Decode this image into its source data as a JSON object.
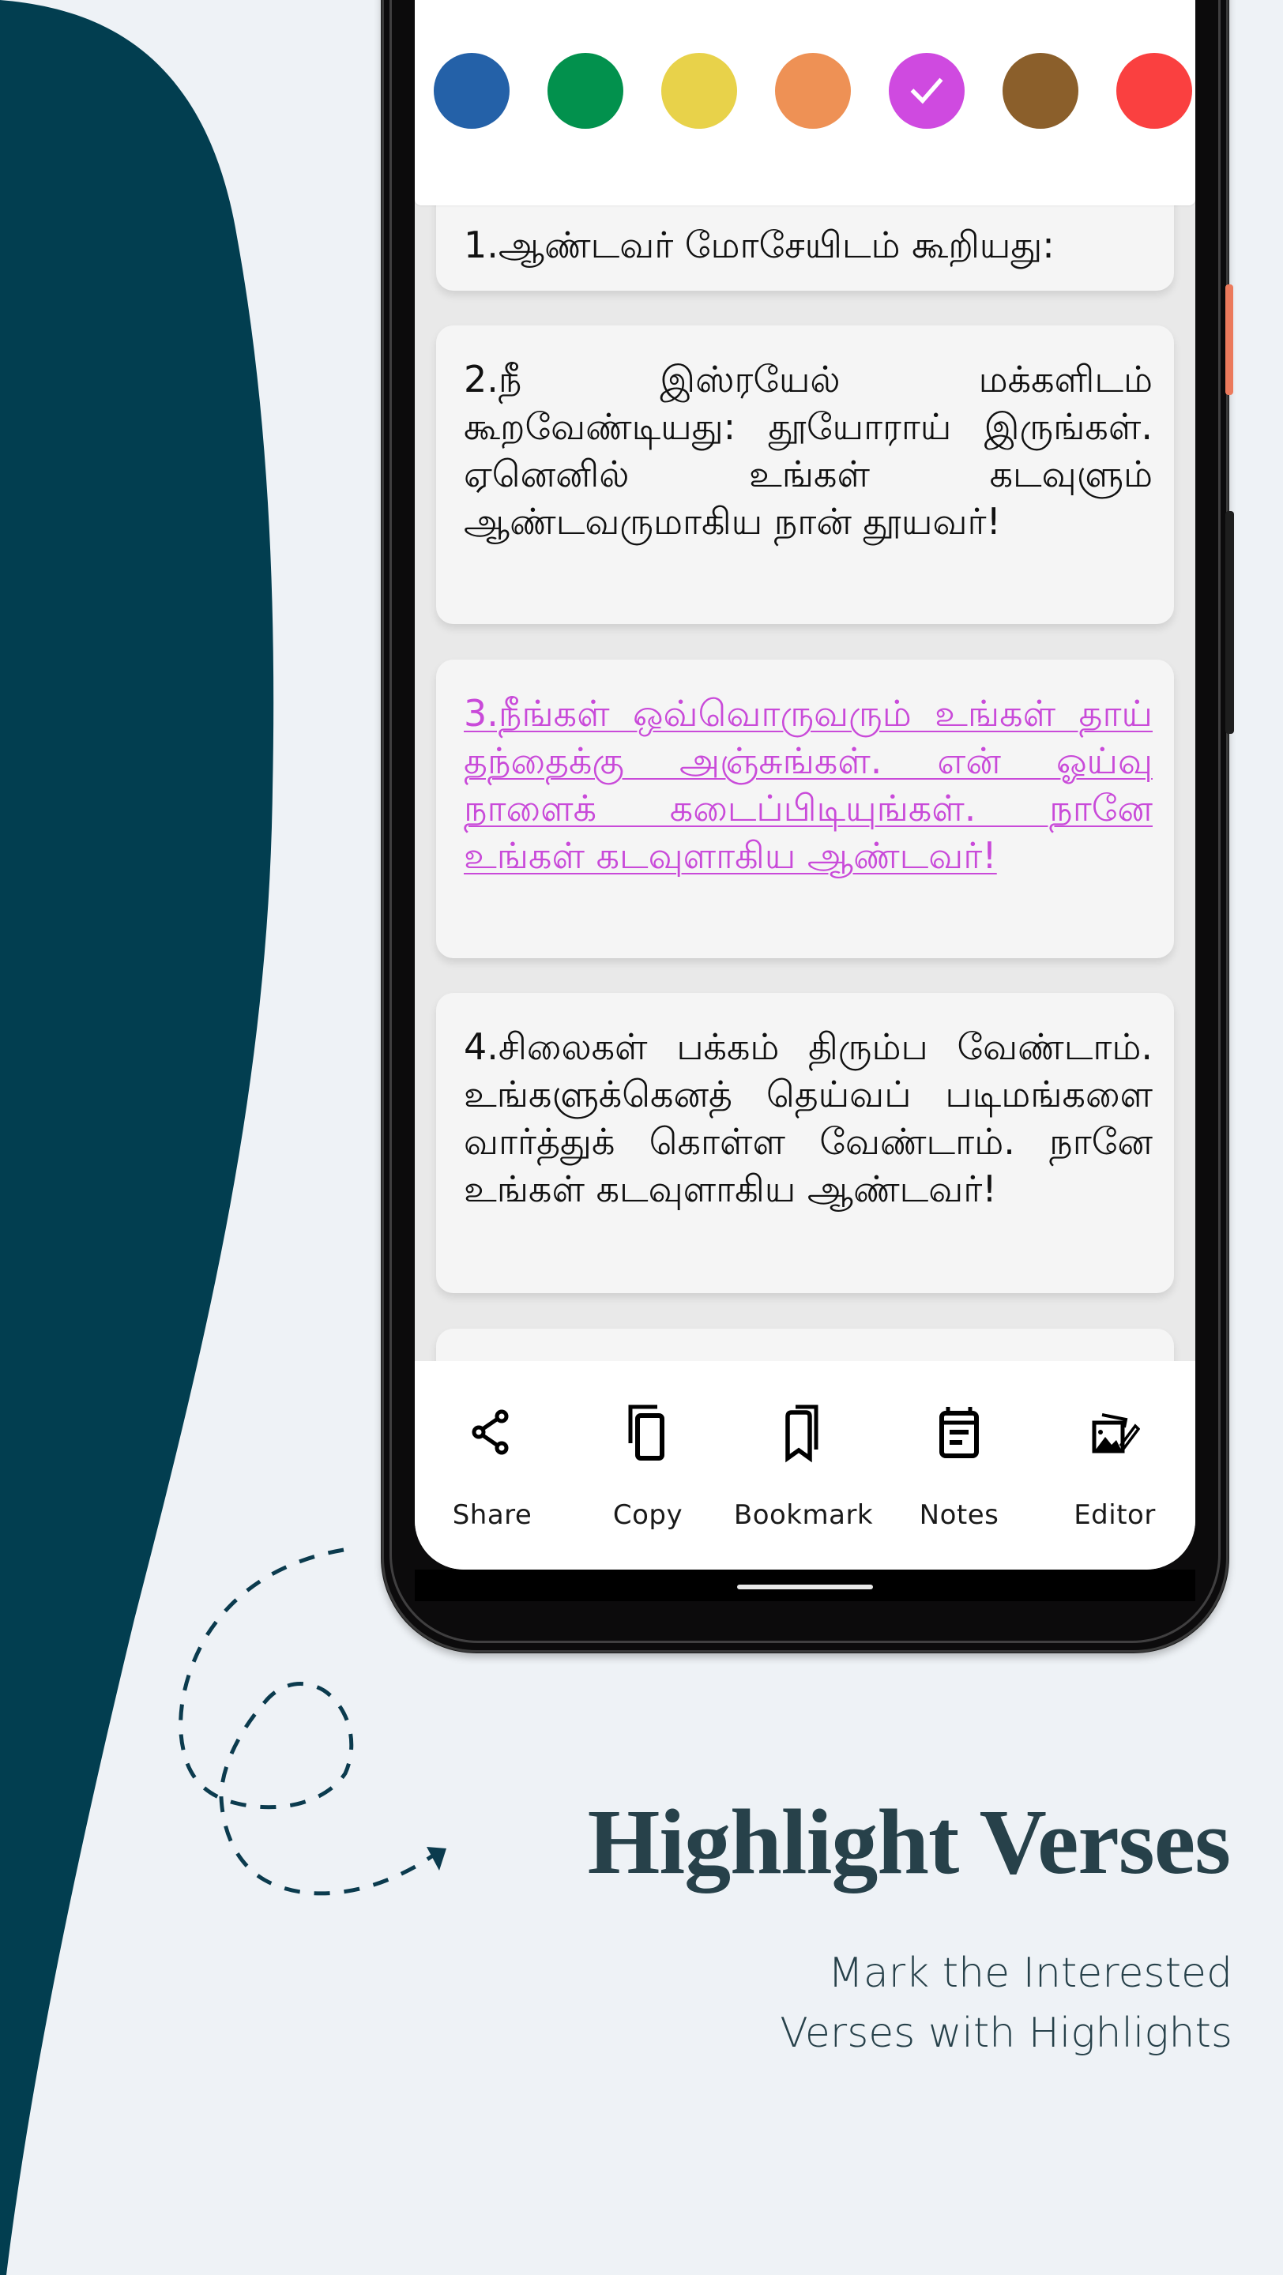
{
  "colors": {
    "background": "#eef2f6",
    "accent_shape": "#023e50",
    "headline": "#27414a",
    "highlight": "#c94ad9"
  },
  "color_picker": {
    "swatches": [
      {
        "name": "blue",
        "color": "#2461a8",
        "selected": false
      },
      {
        "name": "green",
        "color": "#02914d",
        "selected": false
      },
      {
        "name": "yellow",
        "color": "#e8d24a",
        "selected": false
      },
      {
        "name": "orange",
        "color": "#ee9155",
        "selected": false
      },
      {
        "name": "purple",
        "color": "#cf4ae0",
        "selected": true
      },
      {
        "name": "brown",
        "color": "#8b5f2b",
        "selected": false
      },
      {
        "name": "red",
        "color": "#fa4040",
        "selected": false
      }
    ],
    "selected_icon": "check-icon"
  },
  "verses": [
    {
      "text": "1.ஆண்டவர் மோசேயிடம் கூறியது:",
      "highlighted": false
    },
    {
      "text": "2.நீ இஸ்ரயேல் மக்களிடம் கூறவேண்டியது: தூயோராய் இருங்கள். ஏனெனில் உங்கள் கடவுளும் ஆண்டவருமாகிய நான் தூயவர்!",
      "highlighted": false
    },
    {
      "text": "3.நீங்கள் ஒவ்வொருவரும் உங்கள் தாய் தந்தைக்கு அஞ்சுங்கள். என் ஓய்வு நாளைக் கடைப்பிடியுங்கள். நானே உங்கள் கடவுளாகிய ஆண்டவர்!",
      "highlighted": true
    },
    {
      "text": "4.சிலைகள் பக்கம் திரும்ப வேண்டாம். உங்களுக்கெனத் தெய்வப் படிமங்களை வார்த்துக் கொள்ள வேண்டாம். நானே உங்கள் கடவுளாகிய ஆண்டவர்!",
      "highlighted": false
    },
    {
      "text": "",
      "highlighted": false
    }
  ],
  "actions": [
    {
      "label": "Share",
      "icon": "share-icon"
    },
    {
      "label": "Copy",
      "icon": "copy-icon"
    },
    {
      "label": "Bookmark",
      "icon": "bookmark-icon"
    },
    {
      "label": "Notes",
      "icon": "notes-icon"
    },
    {
      "label": "Editor",
      "icon": "image-editor-icon"
    }
  ],
  "marketing": {
    "headline": "Highlight Verses",
    "subtitle_lines": [
      "Mark the Interested",
      "Verses with Highlights"
    ]
  }
}
